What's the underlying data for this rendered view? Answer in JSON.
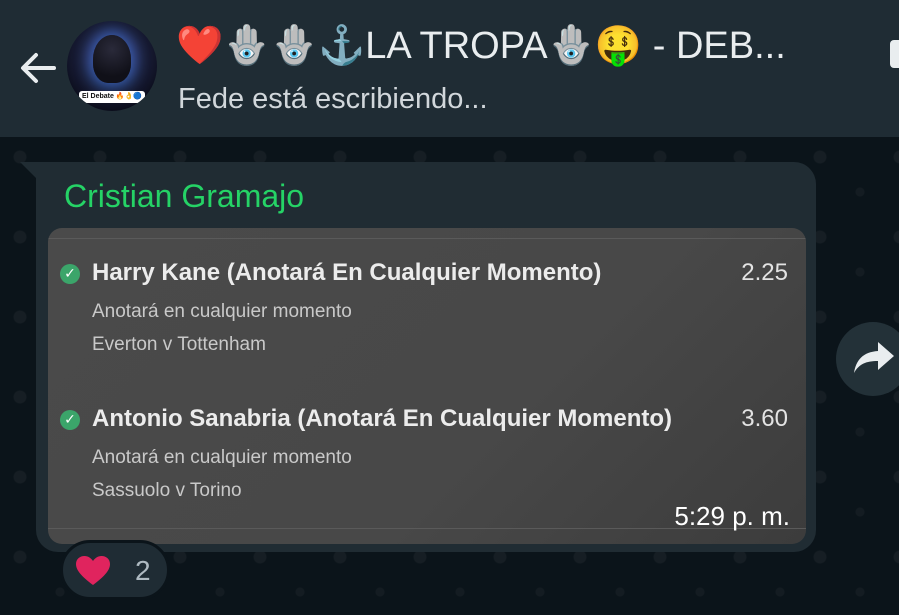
{
  "header": {
    "title": "❤️🪬🪬⚓LA TROPA🪬🤑 - DEB...",
    "subtitle": "Fede está escribiendo...",
    "avatar_caption": "El Debate 🔥👌🔵"
  },
  "message": {
    "sender": "Cristian Gramajo",
    "selections": [
      {
        "name": "Harry Kane (Anotará En Cualquier Momento)",
        "odds": "2.25",
        "market": "Anotará en cualquier momento",
        "event": "Everton v Tottenham"
      },
      {
        "name": "Antonio Sanabria (Anotará En Cualquier Momento)",
        "odds": "3.60",
        "market": "Anotará en cualquier momento",
        "event": "Sassuolo v Torino"
      }
    ],
    "time": "5:29 p. m."
  },
  "reaction": {
    "emoji": "❤️",
    "count": "2"
  },
  "icons": {
    "back": "arrow-left-icon",
    "forward": "forward-icon",
    "check": "check-circle-icon"
  },
  "colors": {
    "header_bg": "#1f2c34",
    "chat_bg": "#0b141a",
    "bubble_bg": "#202c33",
    "sender": "#25d366",
    "check": "#3ba56a",
    "heart": "#e0245e"
  }
}
